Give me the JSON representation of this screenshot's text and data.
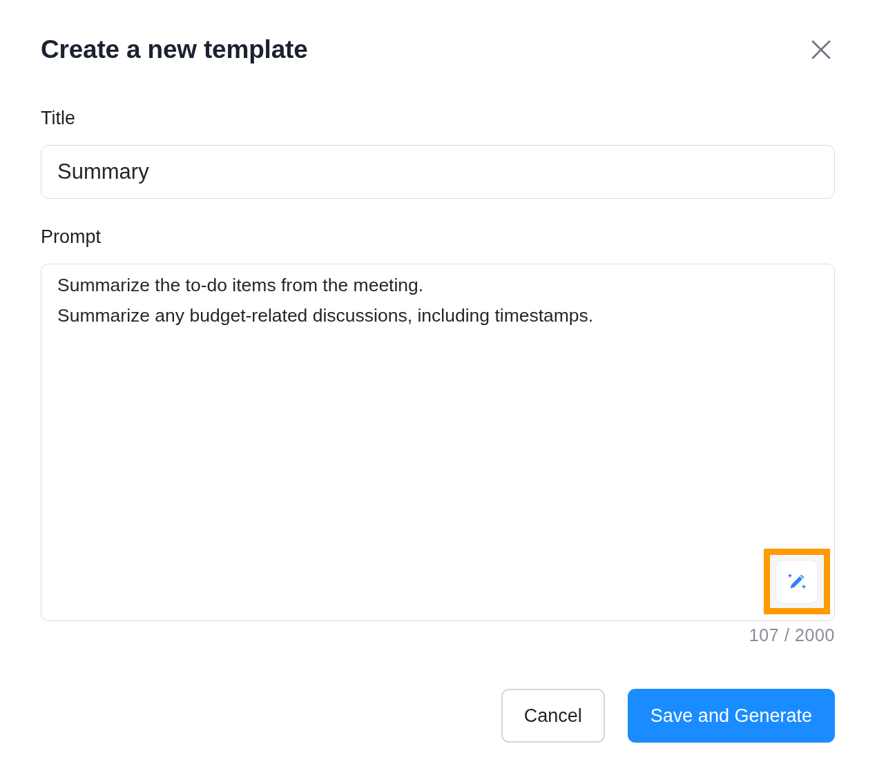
{
  "dialog": {
    "title": "Create a new template"
  },
  "fields": [
    {
      "kind": "input",
      "label": "Title",
      "value": "Summary"
    },
    {
      "kind": "textarea",
      "label": "Prompt",
      "lines": [
        "Summarize the to-do items from the meeting.",
        "Summarize any budget-related discussions, including timestamps."
      ],
      "assist_button": {
        "highlighted": true
      },
      "counter": "107 / 2000"
    }
  ],
  "buttons": [
    {
      "kind": "secondary",
      "label": "Cancel"
    },
    {
      "kind": "primary",
      "label": "Save and Generate"
    }
  ]
}
